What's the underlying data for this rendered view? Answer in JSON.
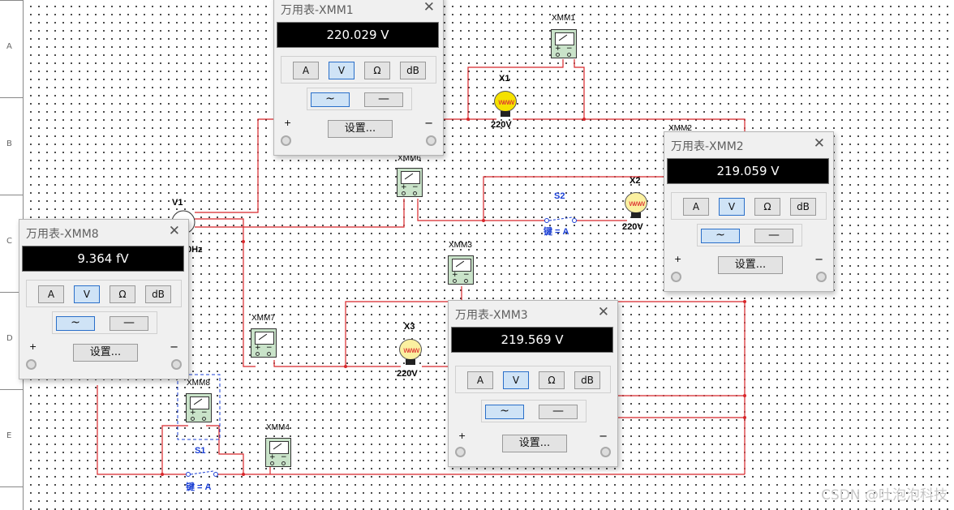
{
  "ruler": {
    "rows": [
      "A",
      "B",
      "C",
      "D",
      "E"
    ]
  },
  "components": {
    "v1": {
      "name": "V1",
      "freq": "0Hz"
    },
    "x1": {
      "name": "X1",
      "rating": "220V"
    },
    "x2": {
      "name": "X2",
      "rating": "220V"
    },
    "x3": {
      "name": "X3",
      "rating": "220V"
    },
    "s1": {
      "name": "S1",
      "key": "键 = A"
    },
    "s2": {
      "name": "S2",
      "key": "键 = A"
    },
    "meters": {
      "xmm1": "XMM1",
      "xmm2": "XMM2",
      "xmm3": "XMM3",
      "xmm4": "XMM4",
      "xmm6": "XMM6",
      "xmm7": "XMM7",
      "xmm8": "XMM8"
    }
  },
  "windows": {
    "xmm1": {
      "title": "万用表-XMM1",
      "reading": "220.029 V"
    },
    "xmm2": {
      "title": "万用表-XMM2",
      "reading": "219.059 V"
    },
    "xmm3": {
      "title": "万用表-XMM3",
      "reading": "219.569 V"
    },
    "xmm8": {
      "title": "万用表-XMM8",
      "reading": "9.364 fV"
    }
  },
  "meter_panel": {
    "modes": [
      "A",
      "V",
      "Ω",
      "dB"
    ],
    "active_mode": "V",
    "ac_symbol": "~",
    "dc_symbol": "—",
    "settings_label": "设置...",
    "plus": "+",
    "minus": "−",
    "close": "✕"
  },
  "colors": {
    "wire": "#d8262a",
    "active_button": "#cfe3f6",
    "display": "#000000"
  },
  "watermark": "CSDN @吐泡泡科技"
}
